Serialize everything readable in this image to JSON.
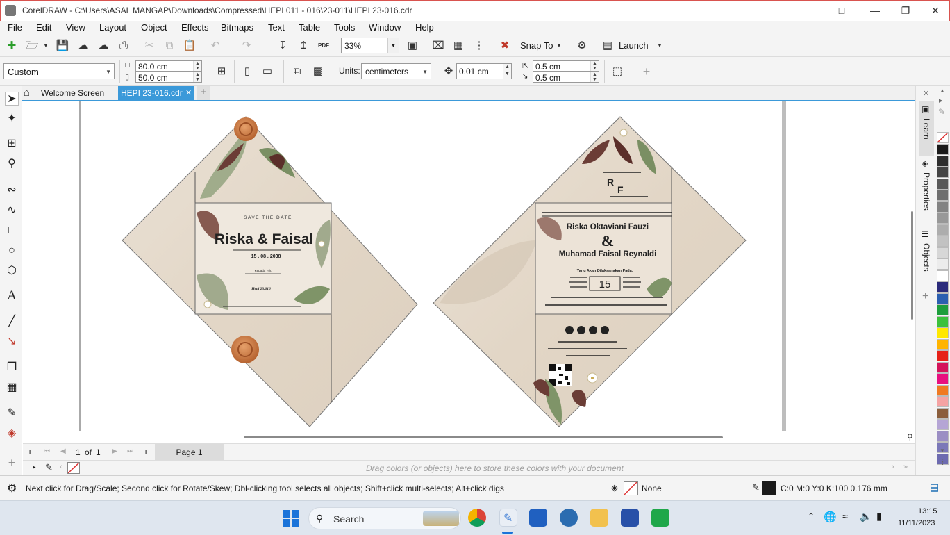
{
  "window": {
    "title": "CorelDRAW - C:\\Users\\ASAL MANGAP\\Downloads\\Compressed\\HEPI 011 - 016\\23-011\\HEPI 23-016.cdr"
  },
  "menu": [
    "File",
    "Edit",
    "View",
    "Layout",
    "Object",
    "Effects",
    "Bitmaps",
    "Text",
    "Table",
    "Tools",
    "Window",
    "Help"
  ],
  "toolbar": {
    "zoom": "33%",
    "snap_to": "Snap To",
    "launch": "Launch",
    "pdf_label": "PDF"
  },
  "propbar": {
    "page_preset": "Custom",
    "width": "80.0 cm",
    "height": "50.0 cm",
    "units_label": "Units:",
    "units_value": "centimeters",
    "nudge": "0.01 cm",
    "dup_x": "0.5 cm",
    "dup_y": "0.5 cm"
  },
  "tabs": {
    "welcome": "Welcome Screen",
    "document": "HEPI 23-016.cdr"
  },
  "dock": {
    "learn": "Learn",
    "properties": "Properties",
    "objects": "Objects"
  },
  "pagebar": {
    "page_index": "1",
    "page_of": "of",
    "page_total": "1",
    "page_tab": "Page 1"
  },
  "doc_palette_hint": "Drag colors (or objects) here to store these colors with your document",
  "status": {
    "hint": "Next click for Drag/Scale; Second click for Rotate/Skew; Dbl-clicking tool selects all objects; Shift+click multi-selects; Alt+click digs",
    "fill": "None",
    "outline": "C:0 M:0 Y:0 K:100  0.176 mm"
  },
  "invite_left": {
    "save_the_date": "SAVE THE DATE",
    "names": "Riska & Faisal",
    "date": "15 . 08 . 2038",
    "kepada": "Kepada Yth:",
    "code": "Hepi 23.016"
  },
  "invite_right": {
    "monogram_r": "R",
    "monogram_f": "F",
    "bride": "Riska Oktaviani Fauzi",
    "amp": "&",
    "groom": "Muhamad Faisal Reynaldi",
    "event": "Yang Akan Dilaksanakan Pada:",
    "day": "15"
  },
  "taskbar": {
    "search": "Search",
    "time": "13:15",
    "date": "11/11/2023"
  },
  "palette_colors": [
    "#1a1a1a",
    "#2e2e2e",
    "#444444",
    "#595959",
    "#6e6e6e",
    "#838383",
    "#989898",
    "#adadad",
    "#c2c2c2",
    "#d7d7d7",
    "#ececec",
    "#ffffff",
    "#2a2a7a",
    "#2b5fb0",
    "#1e9e3c",
    "#3cc13c",
    "#ffe800",
    "#ffb400",
    "#e62117",
    "#d4145a",
    "#e8107f",
    "#f07a21",
    "#f5a3a3",
    "#8b5e3c",
    "#b5a5d5",
    "#9b8ec4",
    "#7b78b8",
    "#6d6bb0"
  ]
}
